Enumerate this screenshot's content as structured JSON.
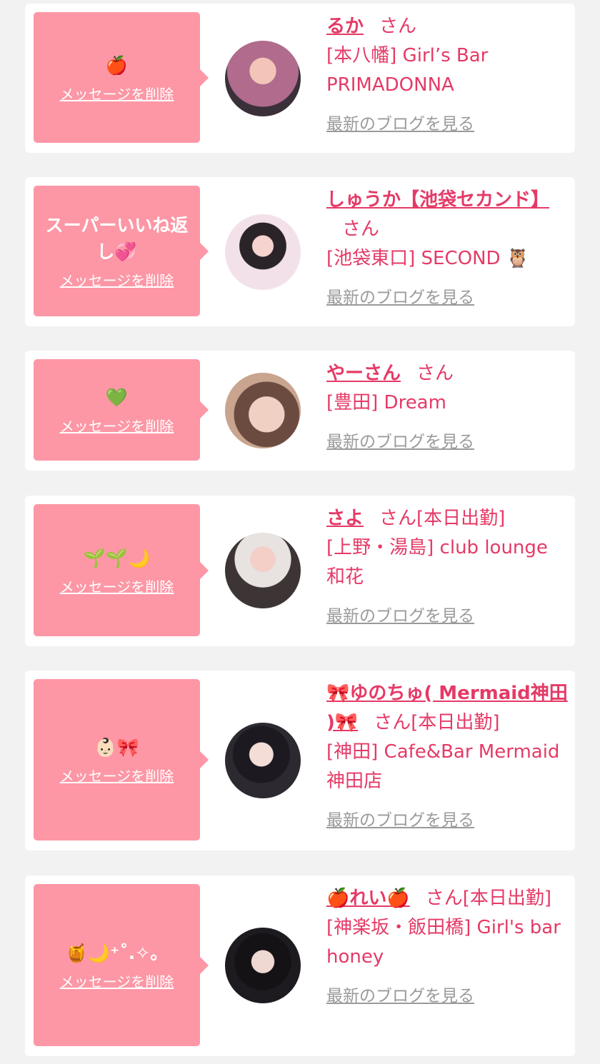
{
  "cards": [
    {
      "bubble_text": "🍎",
      "delete_label": "メッセージを削除",
      "name": "るか",
      "san": "さん",
      "shop": "[本八幡] Girl’s Bar PRIMADONNA",
      "blog_label": "最新のブログを見る"
    },
    {
      "bubble_text": "スーパーいいね返し💞",
      "delete_label": "メッセージを削除",
      "name": "しゅうか【池袋セカンド】",
      "san": "さん",
      "shop": "[池袋東口] SECOND 🦉",
      "blog_label": "最新のブログを見る"
    },
    {
      "bubble_text": "💚",
      "delete_label": "メッセージを削除",
      "name": "やーさん",
      "san": "さん",
      "shop": "[豊田] Dream",
      "blog_label": "最新のブログを見る"
    },
    {
      "bubble_text": "🌱🌱🌙",
      "delete_label": "メッセージを削除",
      "name": "さよ",
      "san": "さん[本日出勤]",
      "shop": "[上野・湯島] club lounge 和花",
      "blog_label": "最新のブログを見る"
    },
    {
      "bubble_text": "👶🏻🎀",
      "delete_label": "メッセージを削除",
      "name": "🎀ゆのちゅ( Mermaid神田 )🎀",
      "san": "さん[本日出勤]",
      "shop": "[神田] Cafe&Bar Mermaid 神田店",
      "blog_label": "最新のブログを見る"
    },
    {
      "bubble_text": "🍯🌙⁺˚.✧。",
      "delete_label": "メッセージを削除",
      "name": "🍎れい🍎",
      "san": "さん[本日出勤]",
      "shop": "[神楽坂・飯田橋] Girl's bar honey",
      "blog_label": "最新のブログを見る"
    }
  ],
  "avatar_colors": [
    "#b06b8d",
    "#f3e1ea",
    "#c9a48f",
    "#3d3535",
    "#2c2a30",
    "#1d1b1f"
  ]
}
